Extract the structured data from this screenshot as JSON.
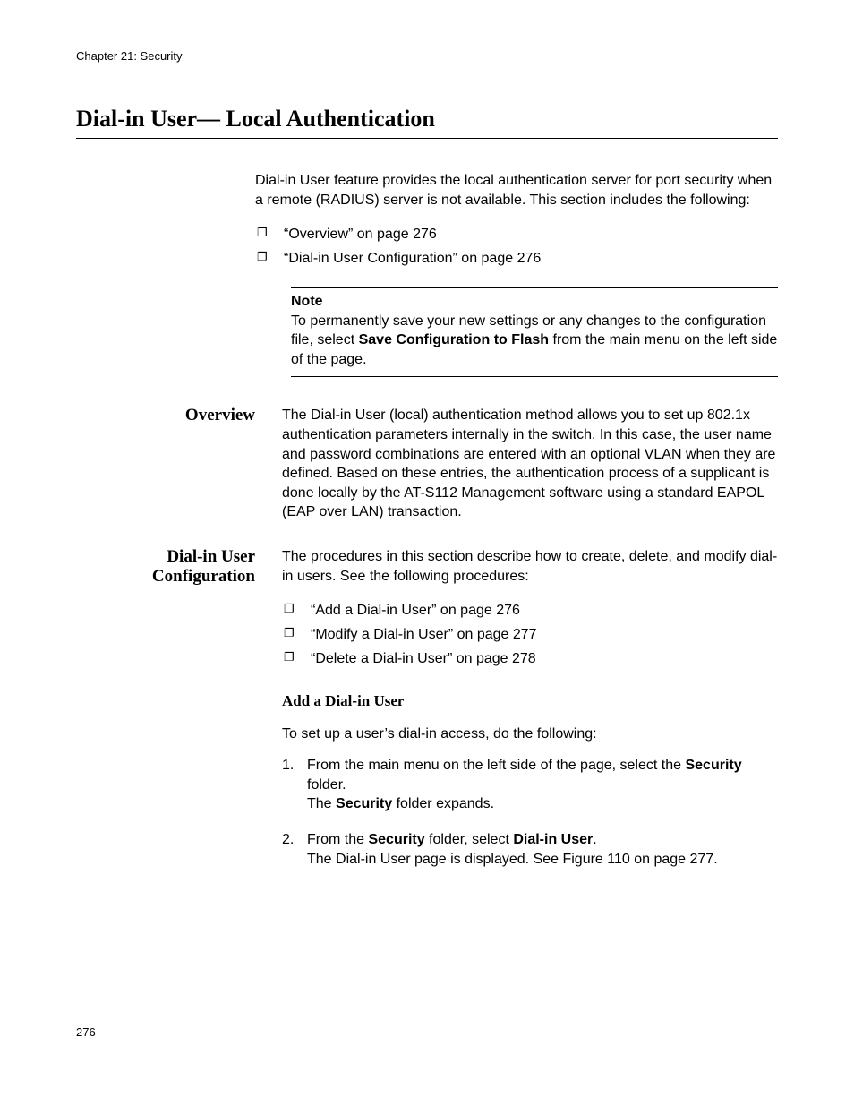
{
  "header": "Chapter 21: Security",
  "title": "Dial-in User— Local Authentication",
  "intro": "Dial-in User feature provides the local authentication server for port security when a remote (RADIUS) server is not available. This section includes the following:",
  "intro_bullets": [
    "“Overview” on page 276",
    "“Dial-in User Configuration” on page 276"
  ],
  "note": {
    "label": "Note",
    "text_before": "To permanently save your new settings or any changes to the configuration file, select ",
    "text_bold": "Save Configuration to Flash",
    "text_after": " from the main menu on the left side of the page."
  },
  "overview": {
    "label": "Overview",
    "text": "The Dial-in User (local) authentication method allows you to set up 802.1x authentication parameters internally in the switch. In this case, the user name and password combinations are entered with an optional VLAN when they are defined. Based on these entries, the authentication process of a supplicant is done locally by the AT-S112 Management software using a standard EAPOL (EAP over LAN) transaction."
  },
  "config": {
    "label": "Dial-in User Configuration",
    "intro": "The procedures in this section describe how to create, delete, and modify dial-in users. See the following procedures:",
    "bullets": [
      "“Add a Dial-in User” on page 276",
      "“Modify a Dial-in User” on page 277",
      "“Delete a Dial-in User” on page 278"
    ],
    "sub_heading": "Add a Dial-in User",
    "sub_intro": "To set up a user’s dial-in access, do the following:",
    "steps": {
      "s1_pre": "From the main menu on the left side of the page, select the ",
      "s1_b1": "Security",
      "s1_mid": " folder.\nThe ",
      "s1_b2": "Security",
      "s1_post": " folder expands.",
      "s2_pre": "From the ",
      "s2_b1": "Security",
      "s2_mid": " folder, select ",
      "s2_b2": "Dial-in User",
      "s2_post": ".\nThe Dial-in User page is displayed. See Figure 110 on page 277."
    }
  },
  "page_number": "276"
}
